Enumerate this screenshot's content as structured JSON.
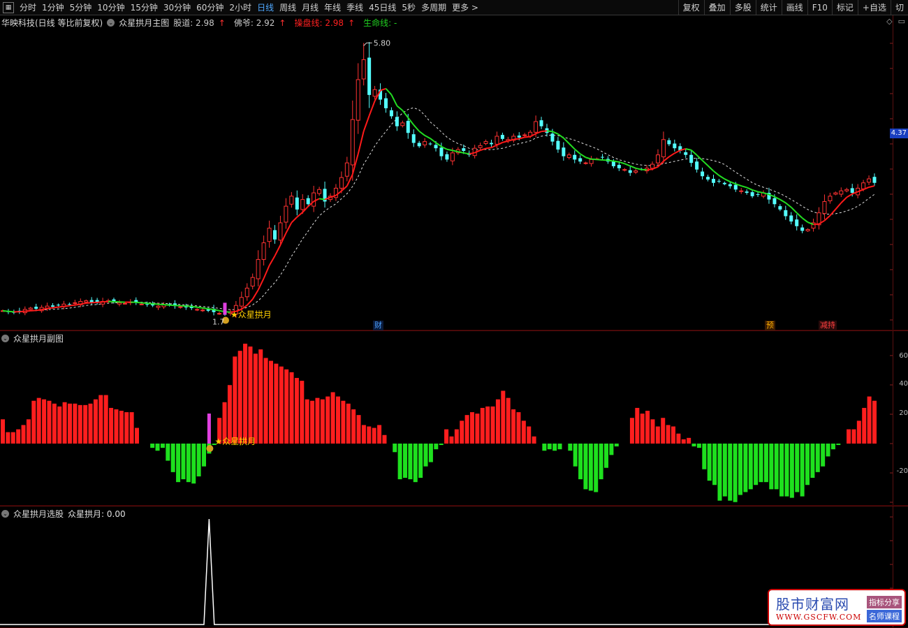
{
  "toolbar": {
    "icon": "grid-icon",
    "periods": [
      "分时",
      "1分钟",
      "5分钟",
      "10分钟",
      "15分钟",
      "30分钟",
      "60分钟",
      "2小时",
      "日线",
      "周线",
      "月线",
      "年线",
      "季线",
      "45日线",
      "5秒",
      "多周期",
      "更多 >"
    ],
    "active_period": "日线",
    "tools": [
      "复权",
      "叠加",
      "多股",
      "统计",
      "画线",
      "F10",
      "标记",
      "+自选",
      "切"
    ]
  },
  "main": {
    "stock_name": "华映科技(日线 等比前复权)",
    "indicator_name": "众星拱月主图",
    "legend": [
      {
        "label": "股道: 2.98",
        "arrow": "↑",
        "color": "#e0e0e0"
      },
      {
        "label": "佛爷: 2.92",
        "arrow": "↑",
        "color": "#e0e0e0"
      },
      {
        "label": "操盘线: 2.98",
        "arrow": "↑",
        "color": "#ff2020"
      },
      {
        "label": "生命线: -",
        "arrow": "",
        "color": "#20d020"
      }
    ],
    "high_label": "5.80",
    "low_label": "1.7",
    "signal_label": "★众星拱月",
    "price_tag": "4.37",
    "event_markers": [
      {
        "text": "财",
        "color": "#2a7fff",
        "bg": "#0a1a3a"
      },
      {
        "text": "预",
        "color": "#ffb000",
        "bg": "#3a1a00"
      },
      {
        "text": "减持",
        "color": "#ff4040",
        "bg": "#2a0a0a"
      }
    ],
    "top_icons": [
      "diamond-icon",
      "window-icon"
    ]
  },
  "sub": {
    "title": "众星拱月副图",
    "signal_label": "★众星拱月",
    "axis_labels": [
      "60",
      "40",
      "20",
      "-20"
    ]
  },
  "selector": {
    "title": "众星拱月选股",
    "value_label": "众星拱月: 0.00"
  },
  "watermark": {
    "title": "股市财富网",
    "url": "WWW.GSCFW.COM",
    "tag1": "指标分享",
    "tag2": "名师课程"
  },
  "chart_data": [
    {
      "type": "candlestick",
      "title": "众星拱月主图",
      "ylim": [
        1.6,
        5.9
      ],
      "note_points": {
        "low": 1.7,
        "high": 5.8,
        "last": 4.37
      },
      "close": [
        1.78,
        1.76,
        1.75,
        1.77,
        1.8,
        1.82,
        1.81,
        1.83,
        1.85,
        1.84,
        1.86,
        1.88,
        1.87,
        1.9,
        1.92,
        1.93,
        1.91,
        1.9,
        1.92,
        1.93,
        1.91,
        1.9,
        1.89,
        1.91,
        1.9,
        1.88,
        1.87,
        1.86,
        1.85,
        1.87,
        1.86,
        1.85,
        1.84,
        1.83,
        1.82,
        1.8,
        1.79,
        1.78,
        1.76,
        1.74,
        1.72,
        1.76,
        1.86,
        1.98,
        2.12,
        2.28,
        2.55,
        2.8,
        3.02,
        2.85,
        3.1,
        3.35,
        3.5,
        3.3,
        3.45,
        3.38,
        3.55,
        3.6,
        3.42,
        3.5,
        3.62,
        3.78,
        4.0,
        4.65,
        5.25,
        5.55,
        5.02,
        5.1,
        4.95,
        4.82,
        4.7,
        4.55,
        4.6,
        4.45,
        4.3,
        4.25,
        4.32,
        4.28,
        4.22,
        4.1,
        4.05,
        4.15,
        4.2,
        4.18,
        4.12,
        4.22,
        4.26,
        4.32,
        4.28,
        4.4,
        4.36,
        4.35,
        4.4,
        4.38,
        4.42,
        4.46,
        4.62,
        4.55,
        4.45,
        4.32,
        4.2,
        4.1,
        4.12,
        4.05,
        4.02,
        4.0,
        4.05,
        4.06,
        4.08,
        4.02,
        3.95,
        3.92,
        3.9,
        3.85,
        3.88,
        3.9,
        3.92,
        3.98,
        4.12,
        4.35,
        4.28,
        4.22,
        4.18,
        4.12,
        4.0,
        3.9,
        3.8,
        3.75,
        3.7,
        3.72,
        3.68,
        3.65,
        3.6,
        3.58,
        3.55,
        3.5,
        3.52,
        3.55,
        3.45,
        3.38,
        3.3,
        3.2,
        3.12,
        3.05,
        2.98,
        3.0,
        3.1,
        3.25,
        3.42,
        3.5,
        3.55,
        3.58,
        3.6,
        3.55,
        3.62,
        3.7,
        3.76,
        3.7
      ]
    },
    {
      "type": "bar",
      "title": "众星拱月副图",
      "ylim": [
        -30,
        70
      ],
      "values": [
        17,
        8,
        8,
        10,
        13,
        17,
        30,
        32,
        31,
        30,
        28,
        26,
        29,
        28,
        28,
        27,
        27,
        28,
        31,
        34,
        34,
        25,
        24,
        23,
        22,
        22,
        11,
        0,
        0,
        -3,
        -5,
        -3,
        -12,
        -20,
        -27,
        -25,
        -27,
        -28,
        -23,
        -16,
        -7,
        -1,
        18,
        29,
        41,
        61,
        65,
        70,
        68,
        63,
        66,
        60,
        58,
        56,
        54,
        52,
        50,
        46,
        44,
        31,
        30,
        32,
        31,
        33,
        36,
        33,
        30,
        28,
        24,
        20,
        13,
        12,
        11,
        13,
        6,
        0,
        -6,
        -25,
        -24,
        -25,
        -27,
        -24,
        -16,
        -13,
        -4,
        -1,
        10,
        5,
        10,
        16,
        20,
        22,
        21,
        25,
        26,
        26,
        31,
        37,
        32,
        24,
        22,
        16,
        12,
        5,
        0,
        -5,
        -4,
        -5,
        -4,
        0,
        -5,
        -16,
        -25,
        -32,
        -33,
        -34,
        -25,
        -17,
        -8,
        -2,
        0,
        0,
        18,
        25,
        21,
        23,
        17,
        12,
        18,
        13,
        12,
        7,
        3,
        4,
        -2,
        -3,
        -18,
        -26,
        -29,
        -40,
        -37,
        -40,
        -41,
        -36,
        -34,
        -32,
        -29,
        -27,
        -27,
        -32,
        -32,
        -37,
        -37,
        -38,
        -34,
        -37,
        -29,
        -24,
        -20,
        -16,
        -9,
        -4,
        -1,
        0,
        10,
        10,
        16,
        25,
        33,
        30
      ]
    }
  ]
}
